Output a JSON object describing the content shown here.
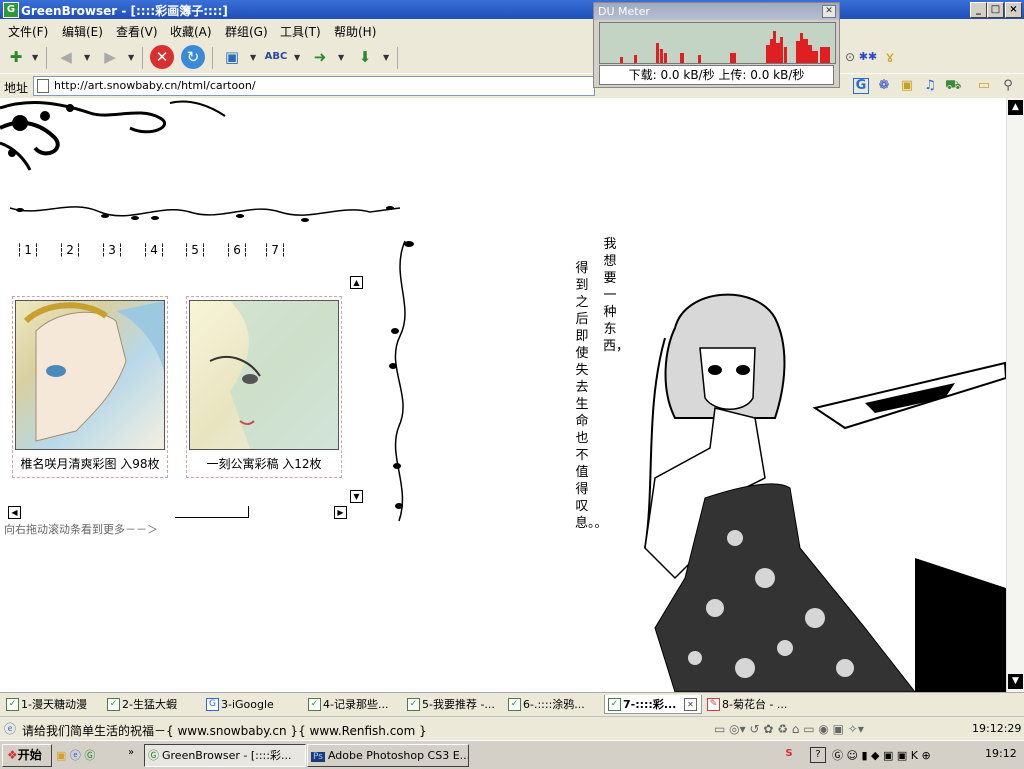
{
  "window": {
    "title": "GreenBrowser - [::::彩画簿子::::]",
    "app_icon": "G",
    "buttons": [
      "_",
      "□",
      "×"
    ]
  },
  "menu": [
    "文件(F)",
    "编辑(E)",
    "查看(V)",
    "收藏(A)",
    "群组(G)",
    "工具(T)",
    "帮助(H)"
  ],
  "toolbar": {
    "icons": [
      "new-tab-icon",
      "back-arrow-icon",
      "forward-arrow-icon",
      "stop-icon",
      "refresh-icon",
      "picture-icon",
      "spell-abc-icon",
      "go-icon",
      "download-icon"
    ]
  },
  "address": {
    "label": "地址",
    "url": "http://art.snowbaby.cn/html/cartoon/"
  },
  "du_meter": {
    "title": "DU Meter",
    "stats": "下载: 0.0 kB/秒  上传: 0.0 kB/秒",
    "colors": {
      "download": "#e02020",
      "background": "#c4d4c4"
    }
  },
  "page": {
    "page_numbers": [
      "1",
      "2",
      "3",
      "4",
      "5",
      "6",
      "7"
    ],
    "thumbnails": [
      {
        "caption": "椎名咲月清爽彩图 入98枚"
      },
      {
        "caption": "一刻公寓彩稿 入12枚"
      }
    ],
    "hint": "向右拖动滚动条看到更多－－＞",
    "vertical_text": {
      "right_column": "我想要一种东西，",
      "left_column": "得到之后即使失去生命也不值得叹息。。"
    }
  },
  "tabs": [
    {
      "label": "1-漫天糖动漫",
      "active": false
    },
    {
      "label": "2-生猛大蝦",
      "active": false
    },
    {
      "label": "3-iGoogle",
      "active": false
    },
    {
      "label": "4-记录那些...",
      "active": false
    },
    {
      "label": "5-我要推荐 -...",
      "active": false
    },
    {
      "label": "6-.::::涂鸦...",
      "active": false
    },
    {
      "label": "7-::::彩...",
      "active": true
    },
    {
      "label": "8-菊花台 - ...",
      "active": false
    }
  ],
  "status": {
    "text": "请给我们简单生活的祝福－{ www.snowbaby.cn }{ www.Renfish.com }",
    "time": "19:12:29"
  },
  "taskbar": {
    "start": "开始",
    "tasks": [
      {
        "label": "GreenBrowser - [::::彩...",
        "active": true
      },
      {
        "label": "Adobe Photoshop CS3 E...",
        "active": false
      }
    ],
    "clock": "19:12"
  }
}
